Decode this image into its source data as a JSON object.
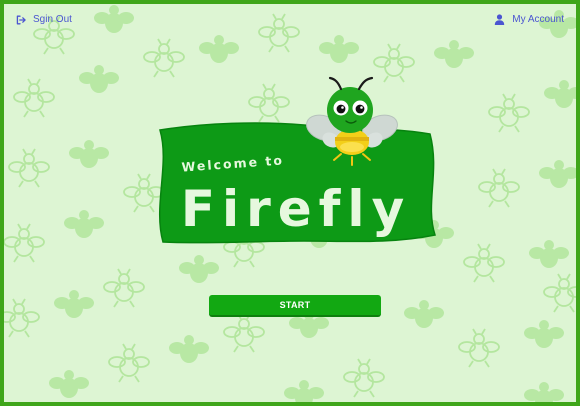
{
  "header": {
    "sign_out_label": "Sgin Out",
    "sign_out_icon": "sign-out-icon",
    "account_label": "My Account",
    "account_icon": "user-icon"
  },
  "hero": {
    "welcome_text": "Welcome to",
    "title": "Firefly",
    "mascot": "firefly-mascot"
  },
  "actions": {
    "start_label": "START"
  },
  "colors": {
    "background": "#ddf5d3",
    "frame": "#3fa61a",
    "banner": "#0d9a16",
    "button": "#12a812",
    "link": "#4b55d1",
    "pattern": "#b4e69f"
  }
}
